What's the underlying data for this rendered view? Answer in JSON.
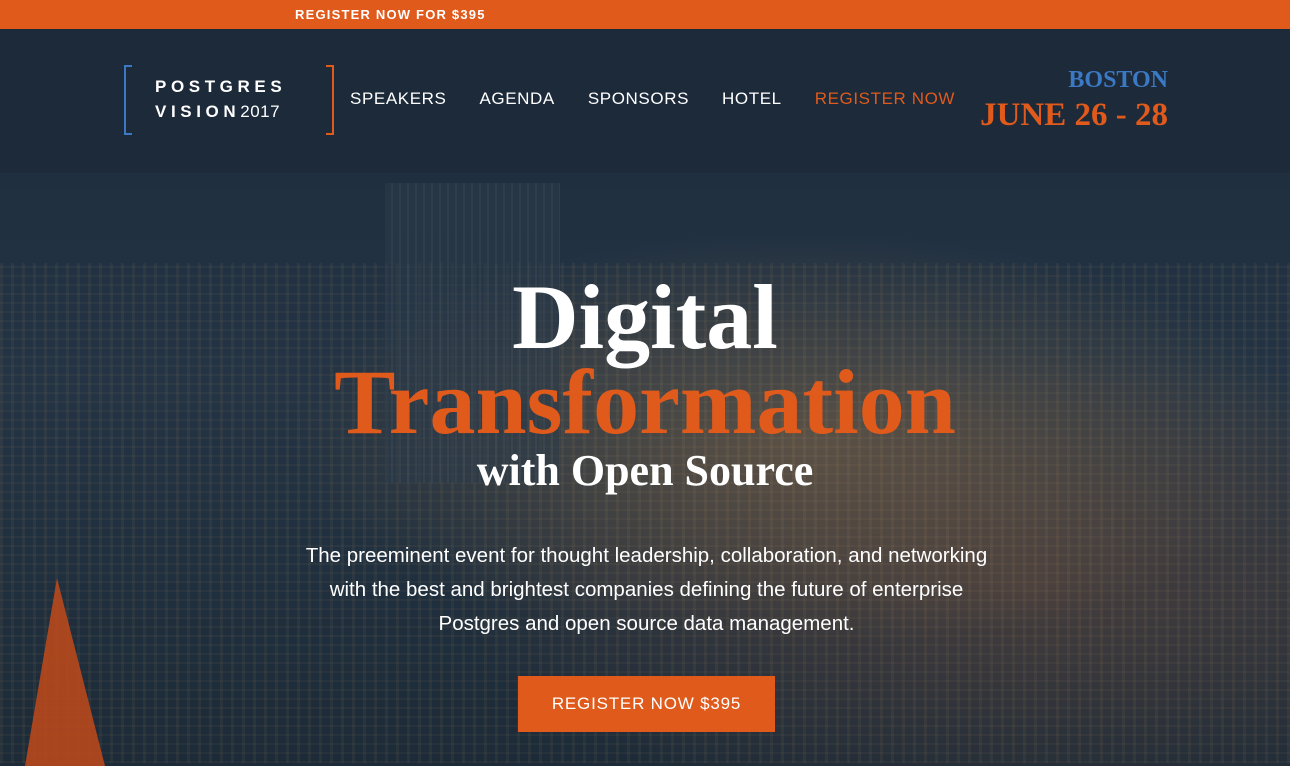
{
  "topbar": {
    "register_text": "REGISTER NOW FOR $395"
  },
  "logo": {
    "line1": "POSTGRES",
    "line2_word": "VISION",
    "year": "2017"
  },
  "nav": {
    "items": [
      {
        "label": "SPEAKERS"
      },
      {
        "label": "AGENDA"
      },
      {
        "label": "SPONSORS"
      },
      {
        "label": "HOTEL"
      },
      {
        "label": "REGISTER NOW"
      }
    ]
  },
  "event": {
    "city": "BOSTON",
    "dates": "JUNE 26 - 28"
  },
  "hero": {
    "title_line1": "Digital",
    "title_line2": "Transformation",
    "title_line3": "with Open Source",
    "description": "The preeminent event for thought leadership, collaboration, and networking with the best and brightest companies defining the future of enterprise Postgres and open source data management.",
    "cta_label": "REGISTER NOW $395"
  },
  "colors": {
    "accent": "#e05a1b",
    "brand_blue": "#3b79c4",
    "header_bg": "#1c2a3a"
  }
}
